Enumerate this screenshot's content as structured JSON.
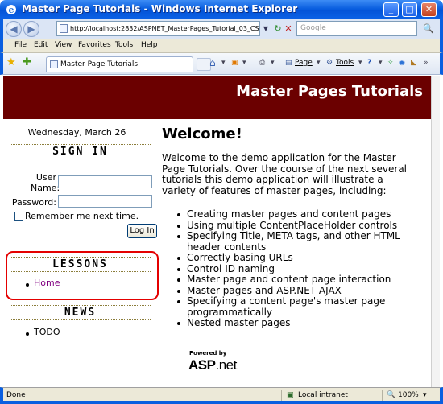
{
  "window": {
    "title": "Master Page Tutorials - Windows Internet Explorer",
    "minimize_label": "_",
    "maximize_label": "□",
    "close_label": "✕"
  },
  "address_bar": {
    "url": "http://localhost:2832/ASPNET_MasterPages_Tutorial_03_CS",
    "search_placeholder": "Google",
    "back_glyph": "◀",
    "forward_glyph": "▶",
    "refresh_glyph": "↻",
    "stop_glyph": "✕",
    "search_glyph": "🔍"
  },
  "menu": [
    "File",
    "Edit",
    "View",
    "Favorites",
    "Tools",
    "Help"
  ],
  "tab_bar": {
    "tab_title": "Master Page Tutorials",
    "commands": {
      "home": "⌂",
      "feeds": "▣",
      "print": "⎙",
      "page": "Page",
      "tools": "Tools",
      "help": "?"
    }
  },
  "page": {
    "header_title": "Master Pages Tutorials",
    "date": "Wednesday, March 26",
    "sign_in": {
      "title": "SIGN IN",
      "user_name_label_1": "User",
      "user_name_label_2": "Name:",
      "password_label": "Password:",
      "remember_label": "Remember me next time.",
      "login_button": "Log In"
    },
    "lessons": {
      "title": "LESSONS",
      "items": [
        "Home"
      ]
    },
    "news": {
      "title": "NEWS",
      "items": [
        "TODO"
      ]
    },
    "main": {
      "heading": "Welcome!",
      "intro": "Welcome to the demo application for the Master Page Tutorials. Over the course of the next several tutorials this demo application will illustrate a variety of features of master pages, including:",
      "features": [
        "Creating master pages and content pages",
        "Using multiple ContentPlaceHolder controls",
        "Specifying Title, META tags, and other HTML header contents",
        "Correctly basing URLs",
        "Control ID naming",
        "Master page and content page interaction",
        "Master pages and ASP.NET AJAX",
        "Specifying a content page's master page programmatically",
        "Nested master pages"
      ],
      "powered_by": "Powered by",
      "asp_logo_1": "ASP",
      "asp_logo_2": ".net"
    }
  },
  "status_bar": {
    "status": "Done",
    "zone": "Local intranet",
    "zoom": "100%"
  },
  "colors": {
    "banner": "#6b0000",
    "title_bar": "#0a5fe0",
    "highlight_box": "#e40000",
    "visited_link": "#800080"
  }
}
